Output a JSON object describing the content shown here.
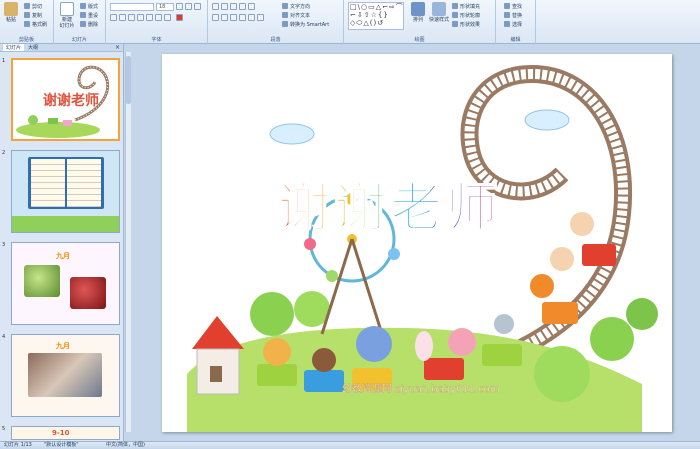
{
  "ribbon": {
    "clipboard": {
      "paste": "粘贴",
      "cut": "剪切",
      "copy": "复制",
      "format_painter": "格式刷",
      "label": "剪贴板"
    },
    "slides": {
      "new_slide": "新建\n幻灯片",
      "layout": "版式",
      "reset": "重设",
      "delete": "删除",
      "label": "幻灯片"
    },
    "font": {
      "font_name": "",
      "font_size": "18",
      "label": "字体"
    },
    "paragraph": {
      "text_direction": "文字方向",
      "align_text": "对齐文本",
      "smartart": "转换为 SmartArt",
      "label": "段落"
    },
    "drawing": {
      "arrange": "排列",
      "quick_styles": "快速样式",
      "shape_fill": "形状填充",
      "shape_outline": "形状轮廓",
      "shape_effects": "形状效果",
      "label": "绘图"
    },
    "editing": {
      "find": "查找",
      "replace": "替换",
      "select": "选择",
      "label": "编辑"
    }
  },
  "panel": {
    "tabs": [
      "幻灯片",
      "大纲"
    ],
    "close": "×",
    "slides": [
      {
        "num": "1",
        "title": "谢谢老师"
      },
      {
        "num": "2",
        "title": ""
      },
      {
        "num": "3",
        "title": "九月"
      },
      {
        "num": "4",
        "title": "九月"
      },
      {
        "num": "5",
        "title": "9-10"
      }
    ]
  },
  "slide": {
    "title": "谢谢老师",
    "watermark": "幼教资源网 ziyuan.baby611.com"
  },
  "status": {
    "slide_info": "幻灯片 1/13",
    "theme": "\"默认设计模板\"",
    "language": "中文(简体，中国)"
  }
}
